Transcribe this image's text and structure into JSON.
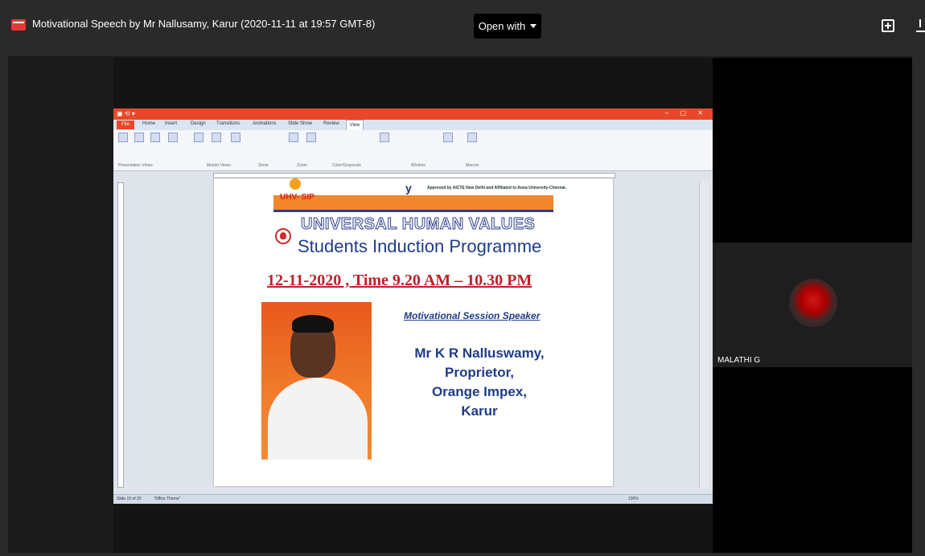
{
  "viewer": {
    "file_title": "Motivational Speech by Mr Nallusamy, Karur (2020-11-11 at 19:57 GMT-8)",
    "open_with_label": "Open with",
    "icons": [
      "video-file-icon",
      "chevron-down-icon",
      "add-to-drive-icon",
      "download-icon"
    ]
  },
  "meeting": {
    "participant_name": "MALATHI G"
  },
  "powerpoint": {
    "tabs": [
      "File",
      "Home",
      "Insert",
      "Design",
      "Transitions",
      "Animations",
      "Slide Show",
      "Review",
      "View"
    ],
    "active_tab": "View",
    "ribbon_groups": [
      "Presentation Views",
      "Master Views",
      "Show",
      "Zoom",
      "Color/Grayscale",
      "Window",
      "Macros"
    ],
    "status_slide": "Slide 19 of 20",
    "status_theme": "\"Office Theme\"",
    "zoom": "100%"
  },
  "slide": {
    "logo_text": "UHV- SIP",
    "approved_text": "Approved by AICTE New Delhi and Affiliated to Anna University-Chennai.",
    "title_line1": "UNIVERSAL HUMAN VALUES",
    "title_line2": "Students Induction Programme",
    "date_line": "12-11-2020 , Time 9.20 AM – 10.30 PM",
    "session_label": "Motivational Session Speaker",
    "speaker_name": "Mr K R Nalluswamy,",
    "speaker_role": "Proprietor,",
    "speaker_company": "Orange Impex,",
    "speaker_city": "Karur"
  }
}
